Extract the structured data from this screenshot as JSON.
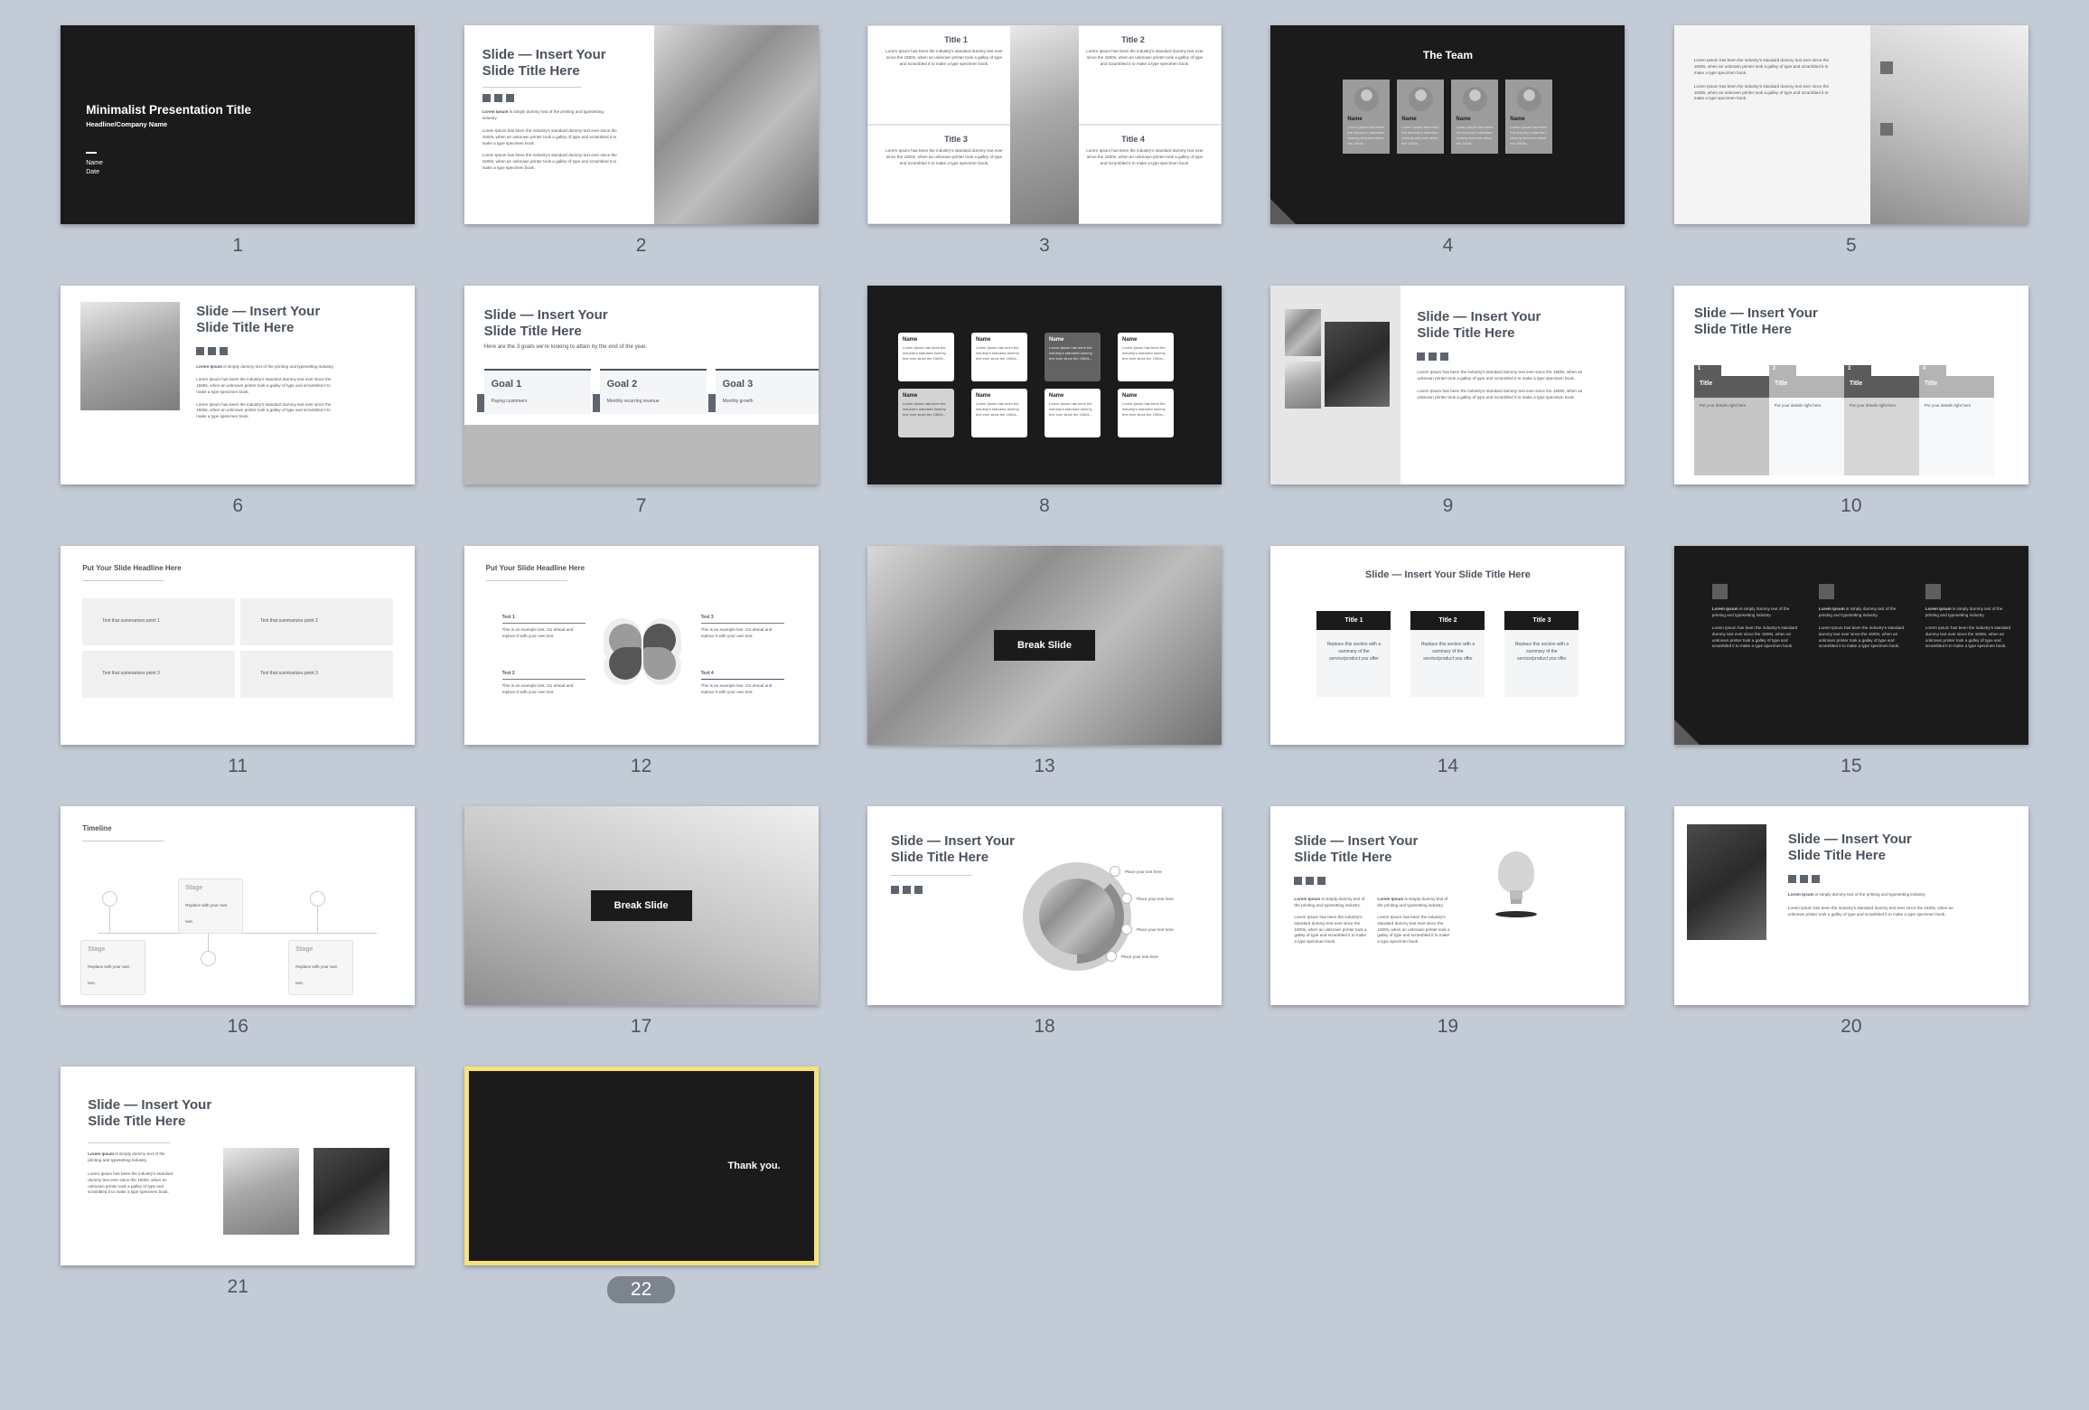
{
  "app": {
    "view": "slide-sorter-grid",
    "background_color": "#c3cbd6",
    "selected_slide": 22,
    "selection_color": "#f5e27c",
    "total_slides": 22
  },
  "common": {
    "slide_title_two_line": "Slide — Insert Your\nSlide Title Here",
    "slide_title_line1": "Slide — Insert Your",
    "slide_title_line2": "Slide Title Here",
    "slide_title_one_line": "Slide — Insert Your Slide Title Here",
    "headline": "Put Your Slide Headline Here",
    "lorem_bold": "Lorem Ipsum",
    "lorem_short": "is simply dummy text of the printing and typesetting industry.",
    "lorem_long": "Lorem Ipsum has been the industry's standard dummy text ever since the 1500s, when an unknown printer took a galley of type and scrambled it to make a type specimen book.",
    "lorem_card": "Lorem Ipsum has been the industry's standard dummy text ever since the 1500s…",
    "name_label": "Name"
  },
  "slides": [
    {
      "number": "1",
      "name": "title-slide",
      "title": "Minimalist Presentation Title",
      "subtitle": "Headline/Company Name",
      "author": "Name",
      "date": "Date",
      "theme": "dark"
    },
    {
      "number": "2",
      "name": "text-with-photo-right",
      "title_line1": "Slide — Insert Your",
      "title_line2": "Slide Title Here",
      "lead_bold": "Lorem Ipsum",
      "lead_rest": " is simply dummy text of the printing and typesetting industry.",
      "para1": "Lorem Ipsum has been the industry's standard dummy text ever since the 1500s, when an unknown printer took a galley of type and scrambled it to make a type specimen book.",
      "para2": "Lorem Ipsum has been the industry's standard dummy text ever since the 1500s, when an unknown printer took a galley of type and scrambled it to make a type specimen book.",
      "photo": "woman-with-laptop-photo"
    },
    {
      "number": "3",
      "name": "four-quadrant-titles",
      "quadrants": [
        {
          "title": "Title 1",
          "body": "Lorem Ipsum has been the industry's standard dummy text ever since the 1500s, when an unknown printer took a galley of type and scrambled it to make a type specimen book."
        },
        {
          "title": "Title 2",
          "body": "Lorem Ipsum has been the industry's standard dummy text ever since the 1500s, when an unknown printer took a galley of type and scrambled it to make a type specimen book."
        },
        {
          "title": "Title 3",
          "body": "Lorem Ipsum has been the industry's standard dummy text ever since the 1500s, when an unknown printer took a galley of type and scrambled it to make a type specimen book."
        },
        {
          "title": "Title 4",
          "body": "Lorem Ipsum has been the industry's standard dummy text ever since the 1500s, when an unknown printer took a galley of type and scrambled it to make a type specimen book."
        }
      ],
      "center_photo": "abstract-paper-fold-photo"
    },
    {
      "number": "4",
      "name": "the-team",
      "title": "The Team",
      "members": [
        {
          "name": "Name",
          "bio": "Lorem Ipsum has been the industry's standard dummy text ever since the 1500s…",
          "avatar": "man-beard-avatar"
        },
        {
          "name": "Name",
          "bio": "Lorem Ipsum has been the industry's standard dummy text ever since the 1500s…",
          "avatar": "woman-afro-avatar"
        },
        {
          "name": "Name",
          "bio": "Lorem Ipsum has been the industry's standard dummy text ever since the 1500s…",
          "avatar": "man-red-shirt-avatar"
        },
        {
          "name": "Name",
          "bio": "Lorem Ipsum has been the industry's standard dummy text ever since the 1500s…",
          "avatar": "woman-blonde-avatar"
        }
      ],
      "theme": "dark"
    },
    {
      "number": "5",
      "name": "text-left-photo-right",
      "para1": "Lorem Ipsum has been the industry's standard dummy text ever since the 1500s, when an unknown printer took a galley of type and scrambled it to make a type specimen book.",
      "para2": "Lorem Ipsum has been the industry's standard dummy text ever since the 1500s, when an unknown printer took a galley of type and scrambled it to make a type specimen book.",
      "photo": "white-desk-lamp-photo"
    },
    {
      "number": "6",
      "name": "photo-left-text-right",
      "title_line1": "Slide — Insert Your",
      "title_line2": "Slide Title Here",
      "lead_bold": "Lorem Ipsum",
      "lead_rest": " is simply dummy text of the printing and typesetting industry.",
      "para1": "Lorem Ipsum has been the industry's standard dummy text ever since the 1500s, when an unknown printer took a galley of type and scrambled it to make a type specimen book.",
      "para2": "Lorem Ipsum has been the industry's standard dummy text ever since the 1500s, when an unknown printer took a galley of type and scrambled it to make a type specimen book.",
      "photo": "perspective-grid-corridor-photo"
    },
    {
      "number": "7",
      "name": "three-goals",
      "title_line1": "Slide — Insert Your",
      "title_line2": "Slide Title Here",
      "subtitle": "Here are the 3 goals we're looking to attain by the end of the year.",
      "goals": [
        {
          "label": "Goal 1",
          "desc": "Paying customers"
        },
        {
          "label": "Goal 2",
          "desc": "Monthly recurring revenue"
        },
        {
          "label": "Goal 3",
          "desc": "Monthly growth"
        }
      ]
    },
    {
      "number": "8",
      "name": "eight-name-cards-dark",
      "cards": [
        {
          "name": "Name",
          "body": "Lorem Ipsum has been the industry's standard dummy text ever since the 1500s…",
          "style": "white"
        },
        {
          "name": "Name",
          "body": "Lorem Ipsum has been the industry's standard dummy text ever since the 1500s…",
          "style": "white"
        },
        {
          "name": "Name",
          "body": "Lorem Ipsum has been the industry's standard dummy text ever since the 1500s…",
          "style": "gray-dark"
        },
        {
          "name": "Name",
          "body": "Lorem Ipsum has been the industry's standard dummy text ever since the 1500s…",
          "style": "white"
        },
        {
          "name": "Name",
          "body": "Lorem Ipsum has been the industry's standard dummy text ever since the 1500s…",
          "style": "gray-light"
        },
        {
          "name": "Name",
          "body": "Lorem Ipsum has been the industry's standard dummy text ever since the 1500s…",
          "style": "white"
        },
        {
          "name": "Name",
          "body": "Lorem Ipsum has been the industry's standard dummy text ever since the 1500s…",
          "style": "white"
        },
        {
          "name": "Name",
          "body": "Lorem Ipsum has been the industry's standard dummy text ever since the 1500s…",
          "style": "white"
        }
      ],
      "theme": "dark"
    },
    {
      "number": "9",
      "name": "photo-collage-left-text-right",
      "title_line1": "Slide — Insert Your",
      "title_line2": "Slide Title Here",
      "para1": "Lorem Ipsum has been the industry's standard dummy text ever since the 1500s, when an unknown printer took a galley of type and scrambled it to make a type specimen book.",
      "para2": "Lorem Ipsum has been the industry's standard dummy text ever since the 1500s, when an unknown printer took a galley of type and scrambled it to make a type specimen book.",
      "photos": [
        "office-photo-1",
        "office-photo-2",
        "office-photo-3"
      ]
    },
    {
      "number": "10",
      "name": "four-column-tab-table",
      "title_line1": "Slide — Insert Your",
      "title_line2": "Slide Title Here",
      "columns": [
        {
          "tag": "1",
          "title": "Title",
          "body": "Put your details right here.",
          "shade": "dark"
        },
        {
          "tag": "2",
          "title": "Title",
          "body": "Put your details right here.",
          "shade": "light"
        },
        {
          "tag": "3",
          "title": "Title",
          "body": "Put your details right here.",
          "shade": "dark"
        },
        {
          "tag": "4",
          "title": "Title",
          "body": "Put your details right here.",
          "shade": "light"
        }
      ]
    },
    {
      "number": "11",
      "name": "four-summary-boxes",
      "headline": "Put Your Slide Headline Here",
      "boxes": [
        "Text that summarizes point 1",
        "Text that summarizes point 2",
        "Text that summarizes point 3",
        "Text that summarizes point 3"
      ]
    },
    {
      "number": "12",
      "name": "four-petal-diagram",
      "headline": "Put Your Slide Headline Here",
      "items": [
        {
          "label": "Text 1",
          "body": "This is an example text. Go ahead and replace it with your own text."
        },
        {
          "label": "Text 2",
          "body": "This is an example text. Go ahead and replace it with your own text."
        },
        {
          "label": "Text 3",
          "body": "This is an example text. Go ahead and replace it with your own text."
        },
        {
          "label": "Text 4",
          "body": "This is an example text. Go ahead and replace it with your own text."
        }
      ]
    },
    {
      "number": "13",
      "name": "break-slide-office",
      "label": "Break Slide",
      "photo": "office-meeting-photo"
    },
    {
      "number": "14",
      "name": "three-title-cards",
      "title": "Slide — Insert Your Slide Title Here",
      "cards": [
        {
          "title": "Title 1",
          "body": "Replace this section with a summary of the service/product you offer"
        },
        {
          "title": "Title 2",
          "body": "Replace this section with a summary of the service/product you offer"
        },
        {
          "title": "Title 3",
          "body": "Replace this section with a summary of the service/product you offer"
        }
      ]
    },
    {
      "number": "15",
      "name": "three-column-dark",
      "columns": [
        {
          "lead_bold": "Lorem Ipsum",
          "lead_rest": " is simply dummy text of the printing and typesetting industry.",
          "body": "Lorem Ipsum has been the industry's standard dummy text ever since the 1500s, when an unknown printer took a galley of type and scrambled it to make a type specimen book."
        },
        {
          "lead_bold": "Lorem Ipsum",
          "lead_rest": " is simply dummy text of the printing and typesetting industry.",
          "body": "Lorem Ipsum has been the industry's standard dummy text ever since the 1500s, when an unknown printer took a galley of type and scrambled it to make a type specimen book."
        },
        {
          "lead_bold": "Lorem Ipsum",
          "lead_rest": " is simply dummy text of the printing and typesetting industry.",
          "body": "Lorem Ipsum has been the industry's standard dummy text ever since the 1500s, when an unknown printer took a galley of type and scrambled it to make a type specimen book."
        }
      ],
      "theme": "dark"
    },
    {
      "number": "16",
      "name": "timeline",
      "headline": "Timeline",
      "stages": [
        {
          "label": "Stage",
          "body": "Replace with your own text.",
          "position": "below"
        },
        {
          "label": "Stage",
          "body": "Replace with your own text.",
          "position": "above"
        },
        {
          "label": "Stage",
          "body": "Replace with your own text.",
          "position": "below"
        }
      ]
    },
    {
      "number": "17",
      "name": "break-slide-building",
      "label": "Break Slide",
      "photo": "white-building-facade-photo"
    },
    {
      "number": "18",
      "name": "circular-callouts",
      "title_line1": "Slide — Insert Your",
      "title_line2": "Slide Title Here",
      "callouts": [
        "Place your text here",
        "Place your text here",
        "Place your text here",
        "Place your text here"
      ],
      "center_photo": "imac-desk-photo"
    },
    {
      "number": "19",
      "name": "lightbulb-two-columns",
      "title_line1": "Slide — Insert Your",
      "title_line2": "Slide Title Here",
      "columns": [
        {
          "lead_bold": "Lorem Ipsum",
          "lead_rest": " is simply dummy text of the printing and typesetting industry.",
          "body": "Lorem Ipsum has been the industry's standard dummy text ever since the 1500s, when an unknown printer took a galley of type and scrambled it to make a type specimen book."
        },
        {
          "lead_bold": "Lorem Ipsum",
          "lead_rest": " is simply dummy text of the printing and typesetting industry.",
          "body": "Lorem Ipsum has been the industry's standard dummy text ever since the 1500s, when an unknown printer took a galley of type and scrambled it to make a type specimen book."
        }
      ],
      "graphic": "lightbulb-icon"
    },
    {
      "number": "20",
      "name": "photo-left-text-right-2",
      "title_line1": "Slide — Insert Your",
      "title_line2": "Slide Title Here",
      "lead_bold": "Lorem Ipsum",
      "lead_rest": " is simply dummy text of the printing and typesetting industry.",
      "para": "Lorem Ipsum has been the industry's standard dummy text ever since the 1500s, when an unknown printer took a galley of type and scrambled it to make a type specimen book.",
      "photo": "laptop-dark-angle-photo"
    },
    {
      "number": "21",
      "name": "text-left-two-photos-right",
      "title_line1": "Slide — Insert Your",
      "title_line2": "Slide Title Here",
      "lead_bold": "Lorem Ipsum",
      "lead_rest": " is simply dummy text of the printing and typesetting industry.",
      "para": "Lorem Ipsum has been the industry's standard dummy text ever since the 1500s, when an unknown printer took a galley of type and scrambled it to make a type specimen book.",
      "photos": [
        "ring-light-presenter-photo",
        "man-at-laptop-photo"
      ]
    },
    {
      "number": "22",
      "name": "thank-you-slide",
      "message": "Thank you.",
      "theme": "dark",
      "selected": true
    }
  ]
}
